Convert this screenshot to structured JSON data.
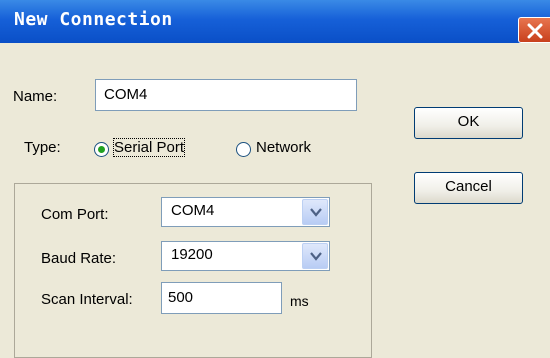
{
  "window": {
    "title": "New Connection",
    "title_bar_color": "#0a4fc7"
  },
  "form": {
    "name_label": "Name:",
    "name_value": "COM4",
    "type_label": "Type:",
    "type_options": [
      {
        "label": "Serial Port",
        "selected": true
      },
      {
        "label": "Network",
        "selected": false
      }
    ]
  },
  "serial_group": {
    "com_port_label": "Com Port:",
    "com_port_value": "COM4",
    "baud_rate_label": "Baud Rate:",
    "baud_rate_value": "19200",
    "scan_interval_label": "Scan Interval:",
    "scan_interval_value": "500",
    "scan_interval_unit": "ms"
  },
  "buttons": {
    "ok": "OK",
    "cancel": "Cancel"
  },
  "icons": {
    "close": "close-icon",
    "dropdown": "chevron-down-icon"
  }
}
